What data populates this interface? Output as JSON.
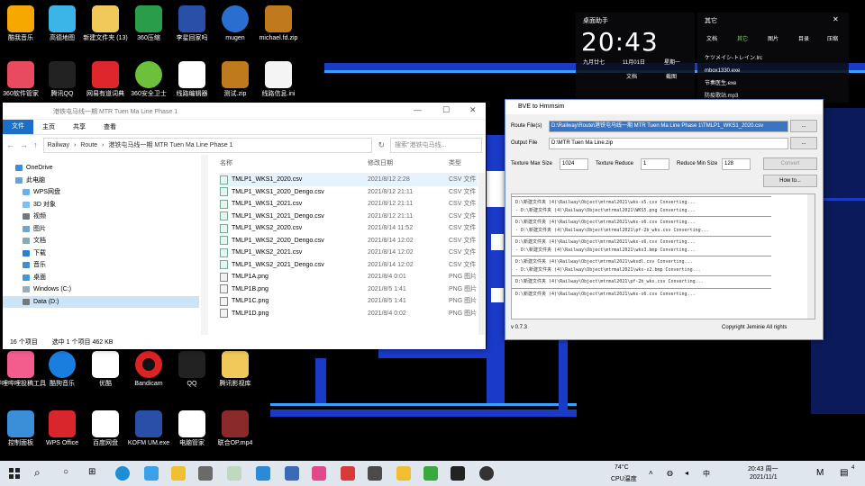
{
  "desktop": {
    "row1": [
      "酷我音乐",
      "高德地图",
      "新建文件夹 (13)",
      "360压缩",
      "李星回家吗",
      "mugen",
      "michael.fd.zip"
    ],
    "row2": [
      "360软件管家",
      "腾讯QQ",
      "网易有道词典",
      "360安全卫士",
      "线路编辑器",
      "测试.zip",
      "线路信息.ini"
    ],
    "row3": [
      "哔哩哔哩投稿工具",
      "酷狗音乐",
      "优酷",
      "Bandicam",
      "QQ",
      "腾讯影视库"
    ],
    "row4": [
      "控制面板",
      "WPS Office",
      "百度网盘",
      "KOFM UM.exe",
      "电脑管家",
      "联合OP.mp4"
    ]
  },
  "explorer": {
    "title": "港铁屯马线一期 MTR Tuen Ma Line Phase 1",
    "tabs": [
      "文件",
      "主页",
      "共享",
      "查看"
    ],
    "path": [
      "Railway",
      "Route",
      "港铁屯马线一期 MTR Tuen Ma Line Phase 1"
    ],
    "search_placeholder": "搜索\"港铁屯马线...",
    "nav": [
      "OneDrive",
      "此电脑",
      "WPS网盘",
      "3D 对象",
      "视频",
      "图片",
      "文档",
      "下载",
      "音乐",
      "桌面",
      "Windows (C:)",
      "Data (D:)"
    ],
    "columns": [
      "名称",
      "修改日期",
      "类型"
    ],
    "files": [
      {
        "name": "TMLP1_WKS1_2020.csv",
        "date": "2021/8/12 2:28",
        "type": "CSV 文件"
      },
      {
        "name": "TMLP1_WKS1_2020_Dengo.csv",
        "date": "2021/8/12 21:11",
        "type": "CSV 文件"
      },
      {
        "name": "TMLP1_WKS1_2021.csv",
        "date": "2021/8/12 21:11",
        "type": "CSV 文件"
      },
      {
        "name": "TMLP1_WKS1_2021_Dengo.csv",
        "date": "2021/8/12 21:11",
        "type": "CSV 文件"
      },
      {
        "name": "TMLP1_WKS2_2020.csv",
        "date": "2021/8/14 11:52",
        "type": "CSV 文件"
      },
      {
        "name": "TMLP1_WKS2_2020_Dengo.csv",
        "date": "2021/8/14 12:02",
        "type": "CSV 文件"
      },
      {
        "name": "TMLP1_WKS2_2021.csv",
        "date": "2021/8/14 12:02",
        "type": "CSV 文件"
      },
      {
        "name": "TMLP1_WKS2_2021_Dengo.csv",
        "date": "2021/8/14 12:02",
        "type": "CSV 文件"
      },
      {
        "name": "TMLP1A.png",
        "date": "2021/8/4 0:01",
        "type": "PNG 图片"
      },
      {
        "name": "TMLP1B.png",
        "date": "2021/8/5 1:41",
        "type": "PNG 图片"
      },
      {
        "name": "TMLP1C.png",
        "date": "2021/8/5 1:41",
        "type": "PNG 图片"
      },
      {
        "name": "TMLP1D.png",
        "date": "2021/8/4 0:02",
        "type": "PNG 图片"
      }
    ],
    "status_count": "16 个项目",
    "status_selected": "选中 1 个项目 462 KB"
  },
  "bve": {
    "title": "BVE to Hmmsim",
    "route_label": "Route File(s)",
    "route_value": "D:\\Railway\\Route\\港铁屯马线一期 MTR Tuen Ma Line Phase 1\\TMLP1_WKS1_2020.csv",
    "output_label": "Output File",
    "output_value": "D:\\MTR Tuen Ma Line.zip",
    "browse": "...",
    "tex_max_label": "Texture Max Size",
    "tex_max": "1024",
    "tex_reduce_label": "Texture Reduce",
    "tex_reduce": "1",
    "reduce_min_label": "Reduce Min Size",
    "reduce_min": "128",
    "convert": "Convert",
    "howto": "How to...",
    "log": [
      "D:\\新建文件夹 (4)\\Railway\\Object\\mtrmal2021\\wks-s5.csv Converting...",
      "- D:\\新建文件夹 (4)\\Railway\\Object\\mtrmal2021\\WKS5.png Converting...",
      "D:\\新建文件夹 (4)\\Railway\\Object\\mtrmal2021\\wks-s6.csv Converting...",
      "- D:\\新建文件夹 (4)\\Railway\\Object\\mtrmal2021\\pf-2b_wks.csv Converting...",
      "D:\\新建文件夹 (4)\\Railway\\Object\\mtrmal2021\\wks-s6.csv Converting...",
      "- D:\\新建文件夹 (4)\\Railway\\Object\\mtrmal2021\\wks3.bmp Converting...",
      "D:\\新建文件夹 (4)\\Railway\\Object\\mtrmal2021\\wksdl.csv Converting...",
      "- D:\\新建文件夹 (4)\\Railway\\Object\\mtrmal2021\\wks-s2.bmp Converting...",
      "D:\\新建文件夹 (4)\\Railway\\Object\\mtrmal2021\\pf-2b_wks.csv Converting...",
      "D:\\新建文件夹 (4)\\Railway\\Object\\mtrmal2021\\wks-s6.csv Converting..."
    ],
    "version": "v 0.7.3",
    "copyright": "Copyright Jeminie All rights"
  },
  "clock_widget": {
    "tab": "桌面助手",
    "time": "20:43",
    "lunar": "九月廿七",
    "date": "11月01日",
    "weekday": "星期一",
    "sub1": "文档",
    "sub2": "截图"
  },
  "files_widget": {
    "header": "其它",
    "tabs": [
      "文档",
      "其它",
      "图片",
      "目录",
      "压缩"
    ],
    "items": [
      "ケツメイシ-トレイン.lrc",
      "mbox1330.exe",
      "节奏医生.exe",
      "防疫歌站.mp3"
    ]
  },
  "taskbar": {
    "temp": "74°C",
    "cpu": "CPU温度",
    "time": "20:43 周一",
    "date": "2021/11/1",
    "notify": "4"
  }
}
